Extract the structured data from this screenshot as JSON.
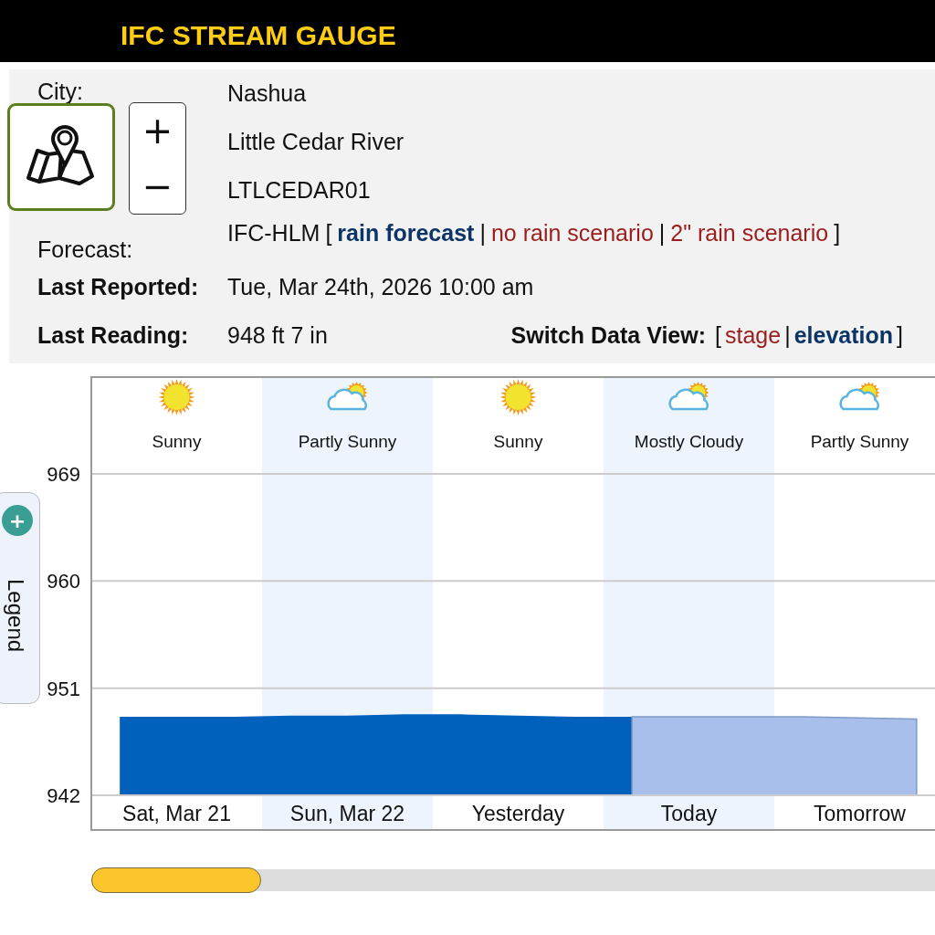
{
  "header": {
    "title": "IFC STREAM GAUGE"
  },
  "info": {
    "rows": [
      {
        "label": "City:",
        "value": "Nashua"
      },
      {
        "value": "Little Cedar River"
      },
      {
        "value": "LTLCEDAR01"
      }
    ],
    "forecast": {
      "label": "Forecast:",
      "model": "IFC-HLM",
      "open": "[",
      "sep": "|",
      "links": [
        {
          "text": "rain forecast",
          "selected": true,
          "color": "#0d3466"
        },
        {
          "text": "no rain scenario",
          "selected": false,
          "color": "#9b1c1c"
        },
        {
          "text": "2\" rain scenario",
          "selected": false,
          "color": "#9b1c1c"
        }
      ],
      "close": "]"
    },
    "last_reported": {
      "label": "Last Reported:",
      "value": "Tue, Mar 24th, 2026 10:00 am"
    },
    "last_reading": {
      "label": "Last Reading:",
      "value": "948 ft 7 in"
    },
    "data_view": {
      "label": "Switch Data View:",
      "open": "[",
      "sep": "|",
      "close": "]",
      "links": [
        {
          "text": "stage",
          "selected": false
        },
        {
          "text": "elevation",
          "selected": true
        }
      ]
    }
  },
  "map_button": {
    "selected": true
  },
  "zoom": {
    "in": "+",
    "out": "−"
  },
  "legend": {
    "plus": "+",
    "label": "Legend"
  },
  "weather": [
    {
      "kind": "sun",
      "text": "Sunny"
    },
    {
      "kind": "cloud-sun",
      "text": "Partly Sunny"
    },
    {
      "kind": "sun",
      "text": "Sunny"
    },
    {
      "kind": "cloud-sun",
      "text": "Mostly Cloudy"
    },
    {
      "kind": "cloud-sun",
      "text": "Partly Sunny"
    }
  ],
  "chart": {
    "chart_data": {
      "type": "area",
      "grid": true,
      "ylim": [
        942,
        977
      ],
      "yticks": [
        942,
        951,
        960,
        969
      ],
      "categories": [
        null,
        "Sat, Mar 21",
        null,
        null,
        "Sun, Mar 22",
        null,
        null,
        "Yesterday",
        null,
        null,
        "Today",
        null,
        null,
        "Tomorrow",
        null
      ],
      "series": [
        {
          "color": "#0061bd",
          "values": [
            948.6,
            948.6,
            948.6,
            948.7,
            948.7,
            948.8,
            948.8,
            948.7,
            948.6,
            948.6,
            null,
            null,
            null,
            null,
            null
          ]
        },
        {
          "color": "#a8bfec",
          "values": [
            null,
            null,
            null,
            null,
            null,
            null,
            null,
            null,
            null,
            948.6,
            948.6,
            948.6,
            948.6,
            948.5,
            948.4
          ]
        }
      ]
    }
  }
}
